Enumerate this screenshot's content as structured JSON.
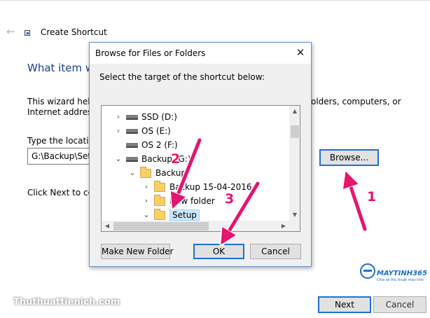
{
  "wizard": {
    "title": "Create Shortcut",
    "heading": "What item w",
    "description_line1_left": "This wizard helps",
    "description_line1_right": "olders, computers, or",
    "description_line2": "Internet addresse",
    "location_label": "Type the location",
    "location_value": "G:\\Backup\\Setu",
    "browse_label": "Browse...",
    "click_next_text": "Click Next to con",
    "next_label": "Next",
    "cancel_label": "Cancel"
  },
  "watermark": {
    "site_text": "Thuthuattienich.com",
    "logo_text": "MAYTINH365",
    "logo_tagline": "Chia sẻ thủ thuật máy tính"
  },
  "dialog": {
    "title": "Browse for Files or Folders",
    "close_symbol": "✕",
    "prompt": "Select the target of the shortcut below:",
    "tree": [
      {
        "label": "SSD (D:)",
        "type": "drive",
        "chevron": "›",
        "level": 1
      },
      {
        "label": "OS (E:)",
        "type": "drive",
        "chevron": "›",
        "level": 1
      },
      {
        "label": "OS 2 (F:)",
        "type": "drive",
        "chevron": "",
        "level": 1
      },
      {
        "label": "Backup (G:)",
        "type": "drive",
        "chevron": "⌄",
        "level": 1
      },
      {
        "label": "Backup",
        "type": "folder",
        "chevron": "⌄",
        "level": 2
      },
      {
        "label": "Backup 15-04-2016",
        "type": "folder",
        "chevron": "›",
        "level": 3
      },
      {
        "label": "New folder",
        "type": "folder",
        "chevron": "›",
        "level": 3
      },
      {
        "label": "Setup",
        "type": "folder",
        "chevron": "⌄",
        "level": 3,
        "selected": true
      }
    ],
    "buttons": {
      "make_new_folder": "Make New Folder",
      "ok": "OK",
      "cancel": "Cancel"
    }
  },
  "annotations": {
    "step1": "1",
    "step2": "2",
    "step3": "3",
    "color": "#e8136f"
  }
}
